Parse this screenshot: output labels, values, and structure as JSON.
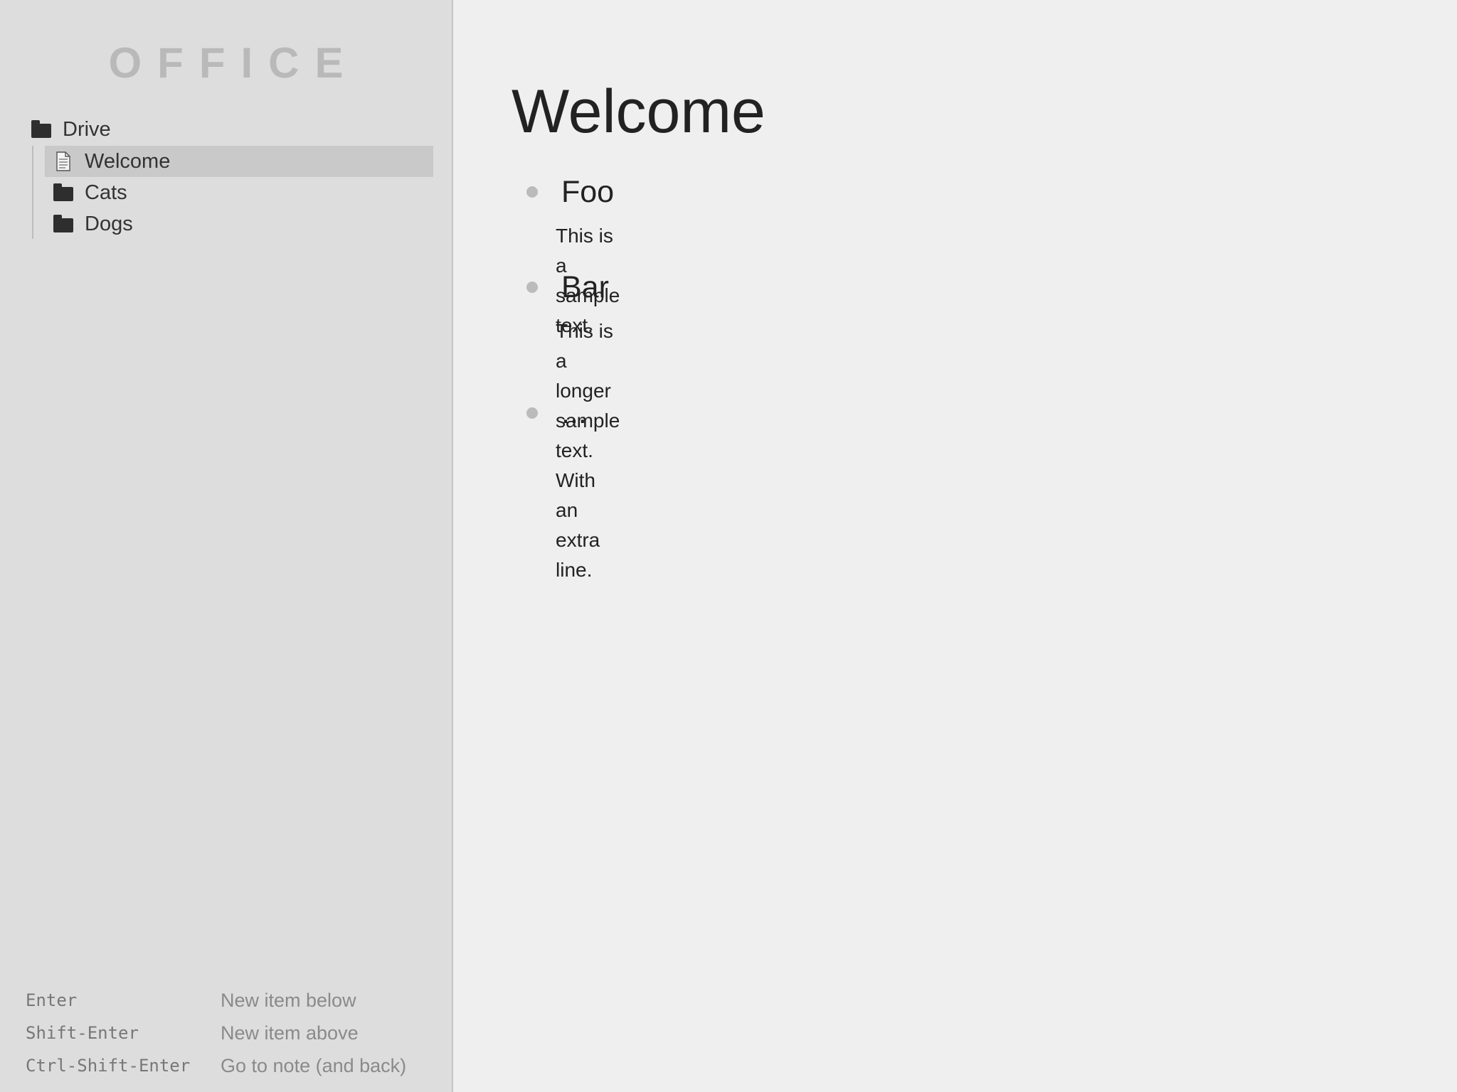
{
  "app": {
    "logo": "OFFICE"
  },
  "sidebar": {
    "root": {
      "label": "Drive",
      "icon": "folder-icon"
    },
    "items": [
      {
        "label": "Welcome",
        "icon": "document-icon",
        "selected": true
      },
      {
        "label": "Cats",
        "icon": "folder-icon",
        "selected": false
      },
      {
        "label": "Dogs",
        "icon": "folder-icon",
        "selected": false
      }
    ],
    "shortcuts": [
      {
        "key": "Enter",
        "desc": "New item below"
      },
      {
        "key": "Shift-Enter",
        "desc": "New item above"
      },
      {
        "key": "Ctrl-Shift-Enter",
        "desc": "Go to note (and back)"
      }
    ]
  },
  "main": {
    "title": "Welcome",
    "items": [
      {
        "title": "Foo",
        "note": "This is a sample text."
      },
      {
        "title": "Bar",
        "note": "This is a longer sample text.\nWith an extra line."
      },
      {
        "title": "...",
        "note": ""
      }
    ]
  },
  "colors": {
    "sidebar_bg": "#dddddd",
    "main_bg": "#efefef",
    "selected_bg": "#c9c9c9",
    "logo": "#b9b9b9",
    "bullet": "#bbbbbb"
  }
}
